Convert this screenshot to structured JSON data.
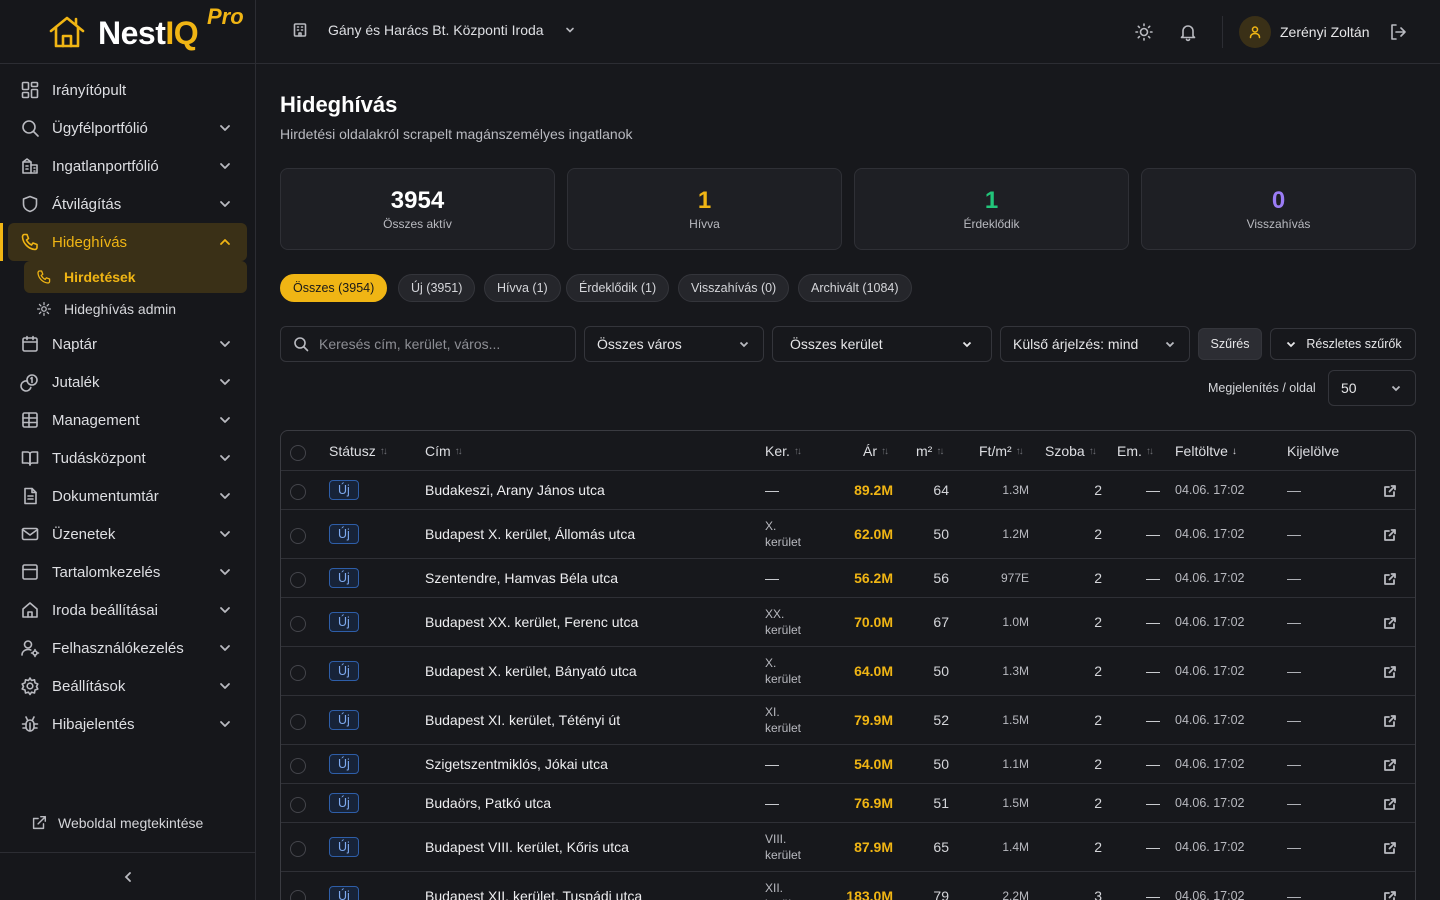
{
  "brand": {
    "name_white": "Nest",
    "name_accent": "IQ",
    "badge": "Pro",
    "accent_color": "#f0b514"
  },
  "header": {
    "office": "Gány és Harács Bt. Központi Iroda",
    "user_name": "Zerényi Zoltán",
    "icons": [
      "sun-icon",
      "bell-icon",
      "user-icon",
      "logout-icon"
    ]
  },
  "sidebar": {
    "items": [
      {
        "label": "Irányítópult",
        "icon": "dashboard-icon",
        "expandable": false
      },
      {
        "label": "Ügyfélportfólió",
        "icon": "search-icon",
        "expandable": true
      },
      {
        "label": "Ingatlanportfólió",
        "icon": "building-icon",
        "expandable": true
      },
      {
        "label": "Átvilágítás",
        "icon": "shield-icon",
        "expandable": true
      },
      {
        "label": "Hideghívás",
        "icon": "phone-icon",
        "expandable": true,
        "active": true
      },
      {
        "label": "Naptár",
        "icon": "calendar-icon",
        "expandable": true
      },
      {
        "label": "Jutalék",
        "icon": "coins-icon",
        "expandable": true
      },
      {
        "label": "Management",
        "icon": "grid-icon",
        "expandable": true
      },
      {
        "label": "Tudásközpont",
        "icon": "book-icon",
        "expandable": true
      },
      {
        "label": "Dokumentumtár",
        "icon": "document-icon",
        "expandable": true
      },
      {
        "label": "Üzenetek",
        "icon": "mail-icon",
        "expandable": true
      },
      {
        "label": "Tartalomkezelés",
        "icon": "layout-icon",
        "expandable": true
      },
      {
        "label": "Iroda beállításai",
        "icon": "home-icon",
        "expandable": true
      },
      {
        "label": "Felhasználókezelés",
        "icon": "user-cog-icon",
        "expandable": true
      },
      {
        "label": "Beállítások",
        "icon": "gear-icon",
        "expandable": true
      },
      {
        "label": "Hibajelentés",
        "icon": "bug-icon",
        "expandable": true
      }
    ],
    "sub_items": [
      {
        "label": "Hirdetések",
        "icon": "phone-icon",
        "active": true
      },
      {
        "label": "Hideghívás admin",
        "icon": "gear-icon",
        "active": false
      }
    ],
    "visit_site": "Weboldal megtekintése"
  },
  "page": {
    "title": "Hideghívás",
    "subtitle": "Hirdetési oldalakról scrapelt magánszemélyes ingatlanok"
  },
  "stats": [
    {
      "value": "3954",
      "label": "Összes aktív",
      "color": "#ffffff"
    },
    {
      "value": "1",
      "label": "Hívva",
      "color": "#f0b514"
    },
    {
      "value": "1",
      "label": "Érdeklődik",
      "color": "#22c57a"
    },
    {
      "value": "0",
      "label": "Visszahívás",
      "color": "#9b7cf5"
    }
  ],
  "tabs": [
    {
      "label": "Összes (3954)",
      "active": true
    },
    {
      "label": "Új (3951)",
      "active": false
    },
    {
      "label": "Hívva (1)",
      "active": false
    },
    {
      "label": "Érdeklődik (1)",
      "active": false
    },
    {
      "label": "Visszahívás (0)",
      "active": false
    },
    {
      "label": "Archivált (1084)",
      "active": false
    }
  ],
  "filters": {
    "search_placeholder": "Keresés cím, kerület, város...",
    "city": "Összes város",
    "district": "Összes kerület",
    "price_rating": "Külső árjelzés: mind",
    "filter_button": "Szűrés",
    "advanced_button": "Részletes szűrők",
    "per_page_label": "Megjelenítés / oldal",
    "per_page": "50"
  },
  "table": {
    "columns": [
      "Státusz",
      "Cím",
      "Ker.",
      "Ár",
      "m²",
      "Ft/m²",
      "Szoba",
      "Em.",
      "Feltöltve",
      "Kijelölve"
    ],
    "rows": [
      {
        "status": "Új",
        "address": "Budakeszi, Arany János utca",
        "district": [
          "—"
        ],
        "price": "89.2M",
        "m2": "64",
        "ftm2": "1.3M",
        "rooms": "2",
        "floor": "—",
        "uploaded": "04.06. 17:02",
        "assigned": "—"
      },
      {
        "status": "Új",
        "address": "Budapest X. kerület, Állomás utca",
        "district": [
          "X.",
          "kerület"
        ],
        "price": "62.0M",
        "m2": "50",
        "ftm2": "1.2M",
        "rooms": "2",
        "floor": "—",
        "uploaded": "04.06. 17:02",
        "assigned": "—"
      },
      {
        "status": "Új",
        "address": "Szentendre, Hamvas Béla utca",
        "district": [
          "—"
        ],
        "price": "56.2M",
        "m2": "56",
        "ftm2": "977E",
        "rooms": "2",
        "floor": "—",
        "uploaded": "04.06. 17:02",
        "assigned": "—"
      },
      {
        "status": "Új",
        "address": "Budapest XX. kerület, Ferenc utca",
        "district": [
          "XX.",
          "kerület"
        ],
        "price": "70.0M",
        "m2": "67",
        "ftm2": "1.0M",
        "rooms": "2",
        "floor": "—",
        "uploaded": "04.06. 17:02",
        "assigned": "—"
      },
      {
        "status": "Új",
        "address": "Budapest X. kerület, Bányató utca",
        "district": [
          "X.",
          "kerület"
        ],
        "price": "64.0M",
        "m2": "50",
        "ftm2": "1.3M",
        "rooms": "2",
        "floor": "—",
        "uploaded": "04.06. 17:02",
        "assigned": "—"
      },
      {
        "status": "Új",
        "address": "Budapest XI. kerület, Tétényi út",
        "district": [
          "XI.",
          "kerület"
        ],
        "price": "79.9M",
        "m2": "52",
        "ftm2": "1.5M",
        "rooms": "2",
        "floor": "—",
        "uploaded": "04.06. 17:02",
        "assigned": "—"
      },
      {
        "status": "Új",
        "address": "Szigetszentmiklós, Jókai utca",
        "district": [
          "—"
        ],
        "price": "54.0M",
        "m2": "50",
        "ftm2": "1.1M",
        "rooms": "2",
        "floor": "—",
        "uploaded": "04.06. 17:02",
        "assigned": "—"
      },
      {
        "status": "Új",
        "address": "Budaörs, Patkó utca",
        "district": [
          "—"
        ],
        "price": "76.9M",
        "m2": "51",
        "ftm2": "1.5M",
        "rooms": "2",
        "floor": "—",
        "uploaded": "04.06. 17:02",
        "assigned": "—"
      },
      {
        "status": "Új",
        "address": "Budapest VIII. kerület, Kőris utca",
        "district": [
          "VIII.",
          "kerület"
        ],
        "price": "87.9M",
        "m2": "65",
        "ftm2": "1.4M",
        "rooms": "2",
        "floor": "—",
        "uploaded": "04.06. 17:02",
        "assigned": "—"
      },
      {
        "status": "Új",
        "address": "Budapest XII. kerület, Tuspádi utca",
        "district": [
          "XII.",
          "kerület"
        ],
        "price": "183.0M",
        "m2": "79",
        "ftm2": "2.2M",
        "rooms": "3",
        "floor": "—",
        "uploaded": "04.06. 17:02",
        "assigned": "—"
      }
    ]
  }
}
